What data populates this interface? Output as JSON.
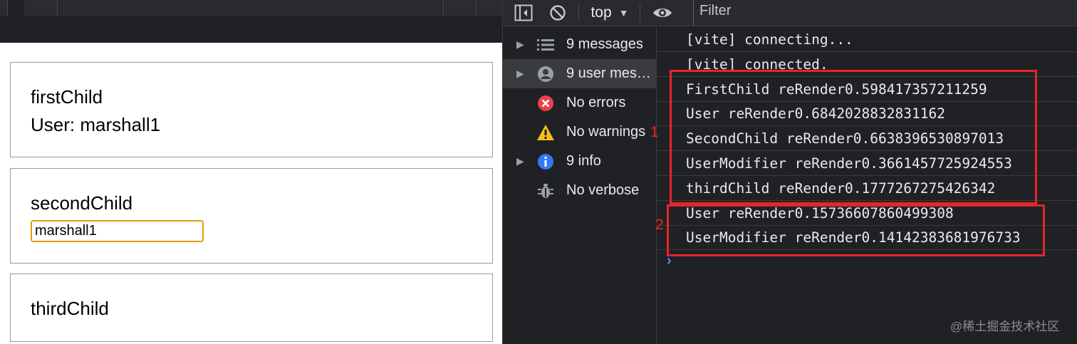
{
  "app": {
    "cards": [
      {
        "title": "firstChild",
        "line": "User: marshall1"
      },
      {
        "title": "secondChild",
        "input_value": "marshall1"
      },
      {
        "title": "thirdChild"
      }
    ]
  },
  "devtools": {
    "toolbar": {
      "context": "top",
      "filter_placeholder": "Filter"
    },
    "sidebar": {
      "items": [
        {
          "label": "9 messages",
          "icon": "list-icon",
          "expandable": true
        },
        {
          "label": "9 user mes…",
          "icon": "user-icon",
          "expandable": true,
          "selected": true
        },
        {
          "label": "No errors",
          "icon": "error-icon",
          "expandable": false
        },
        {
          "label": "No warnings",
          "icon": "warning-icon",
          "expandable": false
        },
        {
          "label": "9 info",
          "icon": "info-icon",
          "expandable": true
        },
        {
          "label": "No verbose",
          "icon": "bug-icon",
          "expandable": false
        }
      ]
    },
    "logs": [
      "[vite] connecting...",
      "[vite] connected.",
      "FirstChild reRender0.598417357211259",
      "User reRender0.6842028832831162",
      "SecondChild reRender0.6638396530897013",
      "UserModifier reRender0.3661457725924553",
      "thirdChild reRender0.1777267275426342",
      "User reRender0.15736607860499308",
      "UserModifier reRender0.14142383681976733"
    ],
    "annotations": [
      "1",
      "2"
    ],
    "watermark": "@稀土掘金技术社区"
  },
  "colors": {
    "annotation_red": "#e3262a",
    "input_focus_border": "#e29a0e",
    "console_bg": "#202124",
    "prompt_blue": "#4d8df6"
  }
}
